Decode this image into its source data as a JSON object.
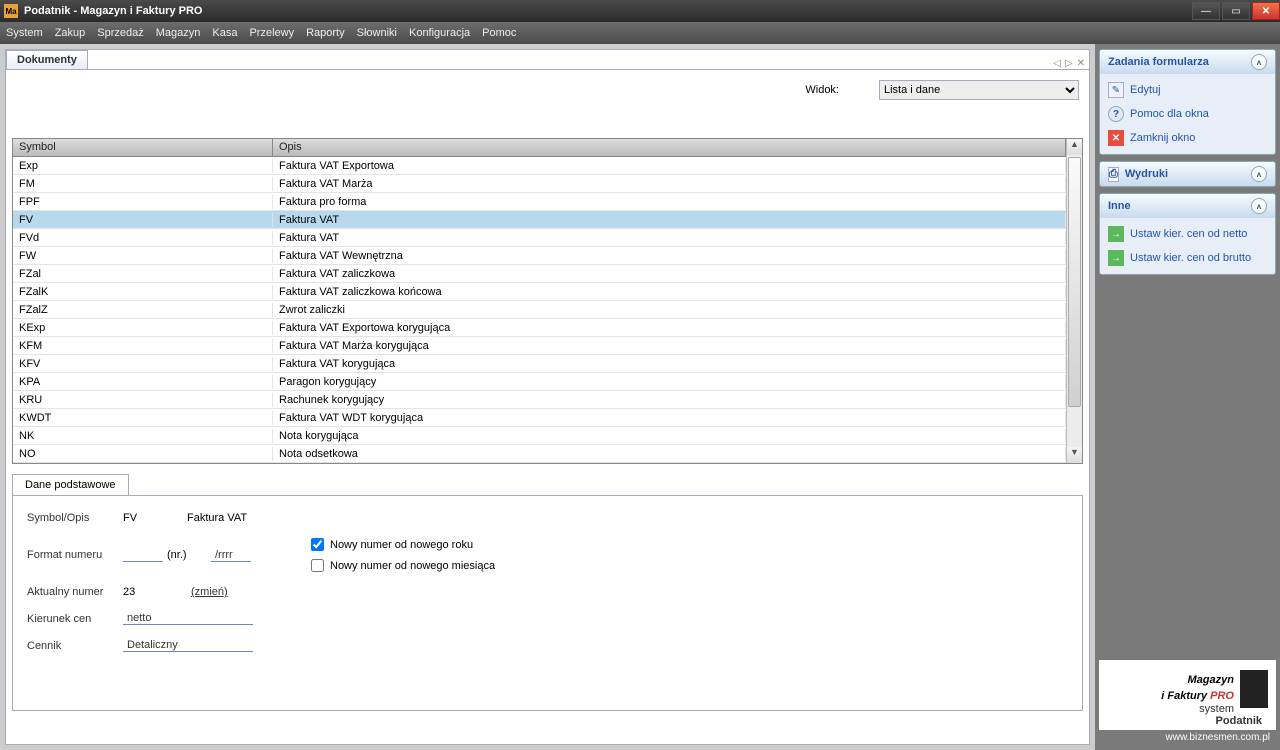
{
  "window": {
    "title": "Podatnik - Magazyn i Faktury PRO"
  },
  "menu": [
    "System",
    "Zakup",
    "Sprzedaż",
    "Magazyn",
    "Kasa",
    "Przelewy",
    "Raporty",
    "Słowniki",
    "Konfiguracja",
    "Pomoc"
  ],
  "doc_tab": "Dokumenty",
  "widok_label": "Widok:",
  "widok_value": "Lista i dane",
  "grid_cols": {
    "symbol": "Symbol",
    "opis": "Opis"
  },
  "rows": [
    {
      "symbol": "Exp",
      "opis": "Faktura VAT Exportowa"
    },
    {
      "symbol": "FM",
      "opis": "Faktura VAT Marża"
    },
    {
      "symbol": "FPF",
      "opis": "Faktura pro forma"
    },
    {
      "symbol": "FV",
      "opis": "Faktura VAT",
      "selected": true
    },
    {
      "symbol": "FVd",
      "opis": "Faktura VAT"
    },
    {
      "symbol": "FW",
      "opis": "Faktura VAT Wewnętrzna"
    },
    {
      "symbol": "FZal",
      "opis": "Faktura VAT zaliczkowa"
    },
    {
      "symbol": "FZalK",
      "opis": "Faktura VAT zaliczkowa końcowa"
    },
    {
      "symbol": "FZalZ",
      "opis": "Zwrot zaliczki"
    },
    {
      "symbol": "KExp",
      "opis": "Faktura VAT Exportowa korygująca"
    },
    {
      "symbol": "KFM",
      "opis": "Faktura VAT Marża korygująca"
    },
    {
      "symbol": "KFV",
      "opis": "Faktura VAT korygująca"
    },
    {
      "symbol": "KPA",
      "opis": "Paragon korygujący"
    },
    {
      "symbol": "KRU",
      "opis": "Rachunek korygujący"
    },
    {
      "symbol": "KWDT",
      "opis": "Faktura VAT WDT korygująca"
    },
    {
      "symbol": "NK",
      "opis": "Nota korygująca"
    },
    {
      "symbol": "NO",
      "opis": "Nota odsetkowa"
    }
  ],
  "detail_tab": "Dane podstawowe",
  "detail": {
    "symbol_opis_label": "Symbol/Opis",
    "symbol": "FV",
    "opis": "Faktura VAT",
    "format_numeru_label": "Format numeru",
    "nr_brace": "(nr.)",
    "suffix": "/rrrr",
    "aktualny_label": "Aktualny numer",
    "aktualny_value": "23",
    "zmien": "(zmień)",
    "kierunek_label": "Kierunek cen",
    "kierunek_value": "netto",
    "cennik_label": "Cennik",
    "cennik_value": "Detaliczny",
    "chk1": "Nowy numer od nowego roku",
    "chk2": "Nowy numer od nowego miesiąca"
  },
  "side": {
    "panel1_title": "Zadania formularza",
    "edit": "Edytuj",
    "help": "Pomoc dla okna",
    "close": "Zamknij okno",
    "panel2_title": "Wydruki",
    "panel3_title": "Inne",
    "netto": "Ustaw kier. cen od netto",
    "brutto": "Ustaw kier. cen od brutto"
  },
  "brand": {
    "line1": "Magazyn",
    "line2": "i Faktury ",
    "pro": "PRO",
    "system": "system",
    "podatnik": "Podatnik",
    "url": "www.biznesmen.com.pl"
  }
}
